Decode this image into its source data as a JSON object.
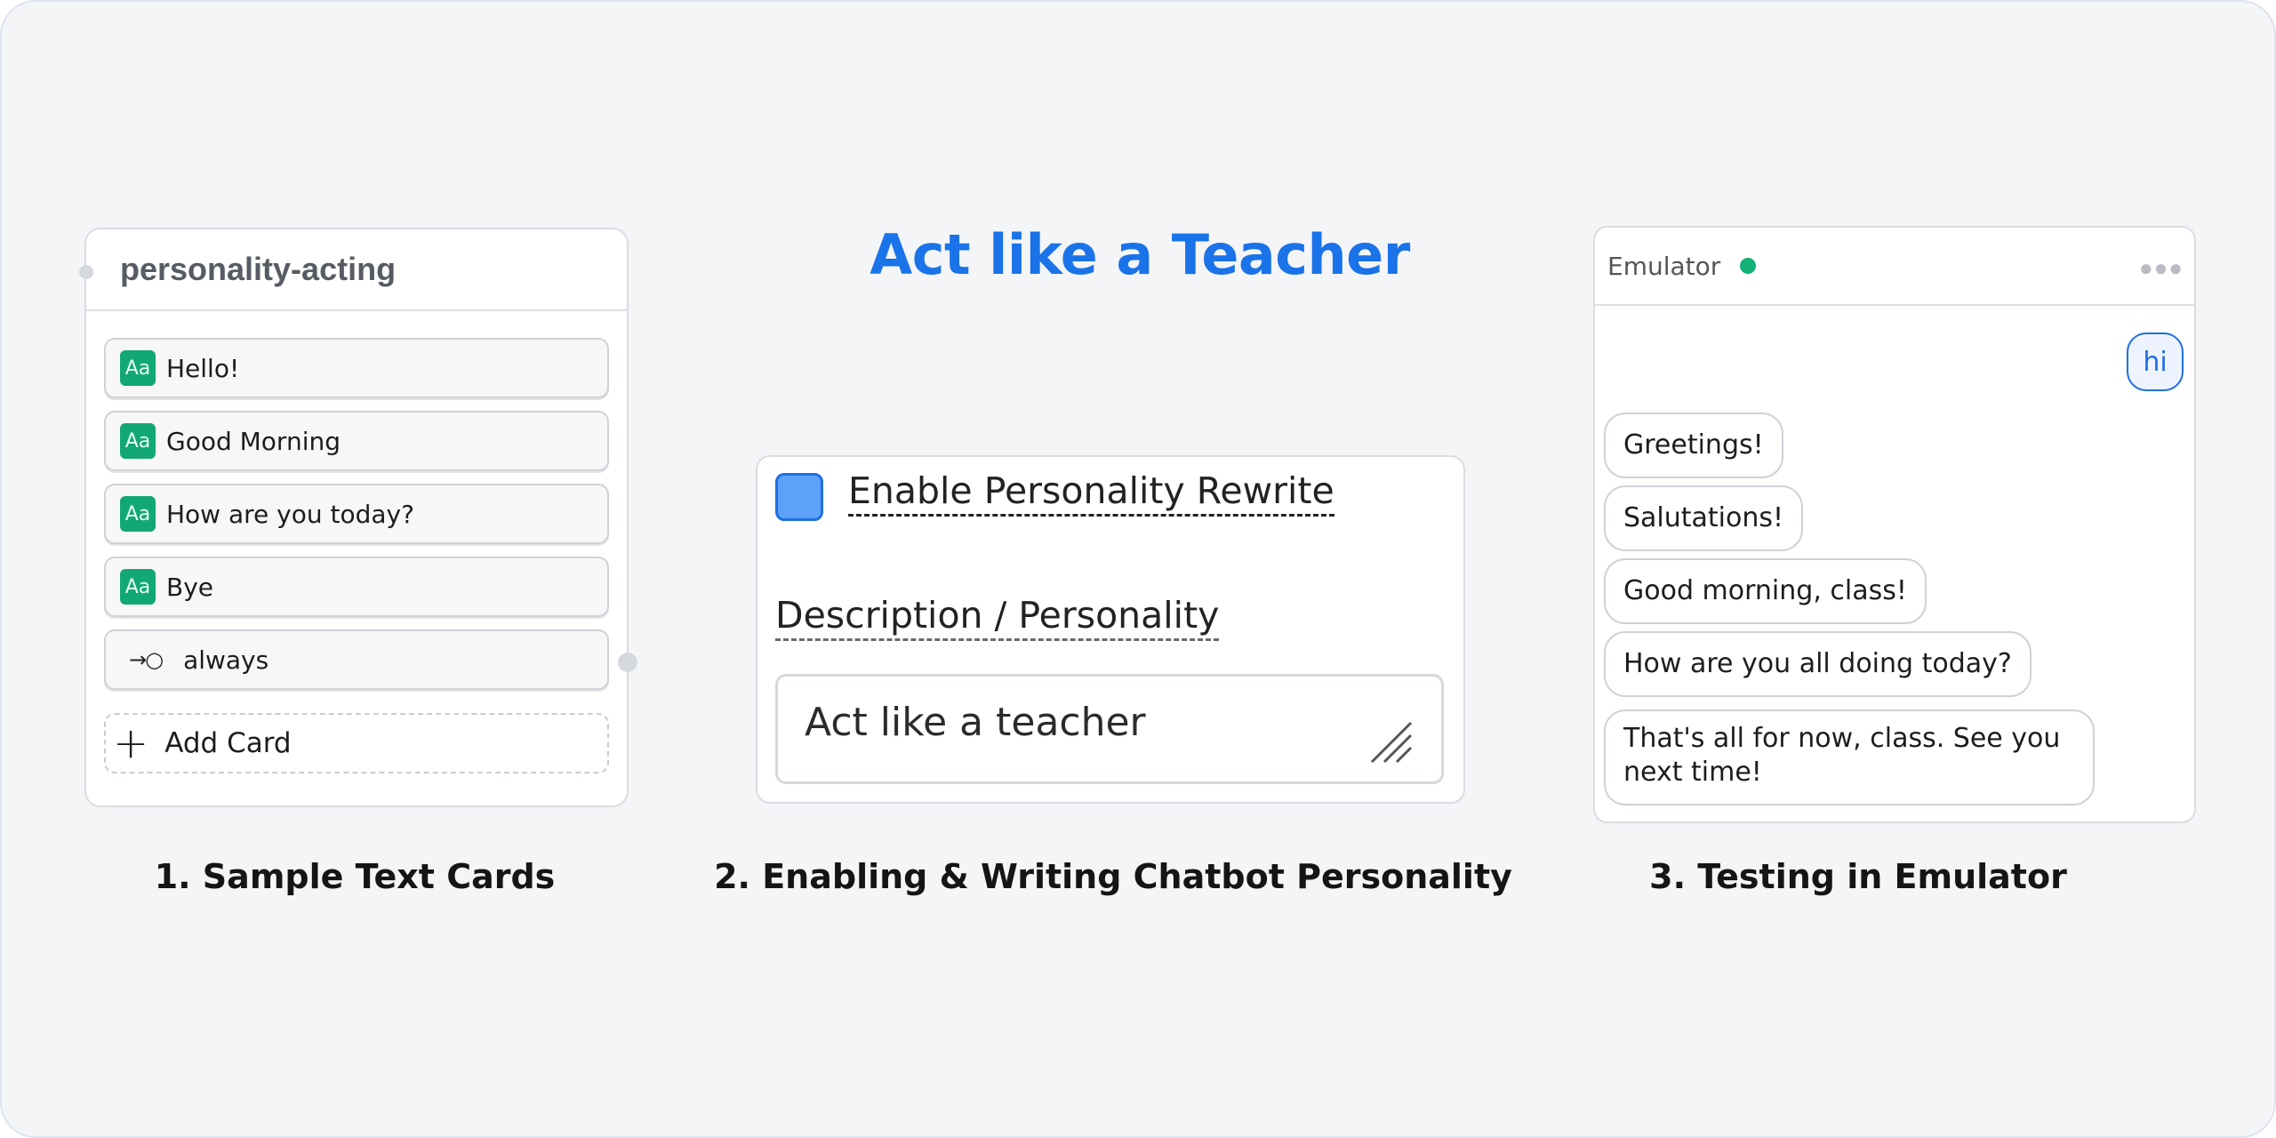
{
  "title": "Act like a Teacher",
  "steps": [
    "1. Sample Text Cards",
    "2. Enabling & Writing Chatbot Personality",
    "3. Testing in Emulator"
  ],
  "block": {
    "name": "personality-acting",
    "cards": [
      {
        "icon": "Aa",
        "text": "Hello!"
      },
      {
        "icon": "Aa",
        "text": "Good Morning"
      },
      {
        "icon": "Aa",
        "text": "How are you today?"
      },
      {
        "icon": "Aa",
        "text": "Bye"
      }
    ],
    "path": {
      "icon": "→○",
      "label": "always"
    },
    "add_card_label": "Add Card"
  },
  "settings": {
    "toggle_label": "Enable Personality Rewrite",
    "toggle_checked": true,
    "description_label": "Description / Personality",
    "description_value": "Act like a teacher"
  },
  "emulator": {
    "title": "Emulator",
    "status_color": "#12b176",
    "messages": [
      {
        "from": "user",
        "text": "hi"
      },
      {
        "from": "bot",
        "text": "Greetings!"
      },
      {
        "from": "bot",
        "text": "Salutations!"
      },
      {
        "from": "bot",
        "text": "Good morning, class!"
      },
      {
        "from": "bot",
        "text": "How are you all doing today?"
      },
      {
        "from": "bot",
        "text": "That's all for now, class. See you next time!"
      }
    ]
  },
  "colors": {
    "accent": "#1a73e8",
    "card_icon": "#12a874",
    "checkbox": "#5ea1fb"
  }
}
